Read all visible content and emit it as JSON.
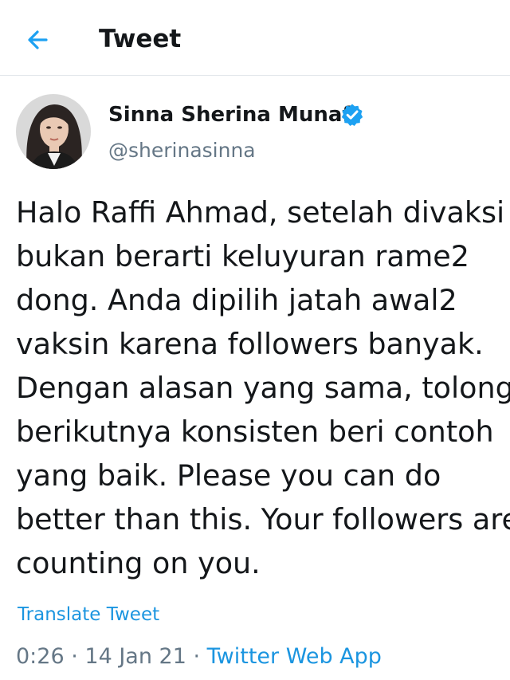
{
  "header": {
    "title": "Tweet",
    "back_icon": "arrow-left-icon",
    "accent_color": "#1da1f2"
  },
  "tweet": {
    "author": {
      "display_name": "Sinna Sherina Munaf",
      "handle": "@sherinasinna",
      "verified": true,
      "verified_icon": "verified-badge-icon"
    },
    "lines": [
      "Halo Raffi Ahmad, setelah divaksi",
      "bukan berarti keluyuran rame2",
      "dong. Anda dipilih jatah awal2",
      "vaksin karena followers banyak.",
      "Dengan alasan yang sama, tolong",
      "berikutnya konsisten beri contoh",
      "yang baik. Please you can do",
      "better than this. Your followers are",
      "counting on you."
    ],
    "translate_label": "Translate Tweet",
    "time": "0:26",
    "date": "14 Jan 21",
    "separator": " · ",
    "source": "Twitter Web App"
  }
}
